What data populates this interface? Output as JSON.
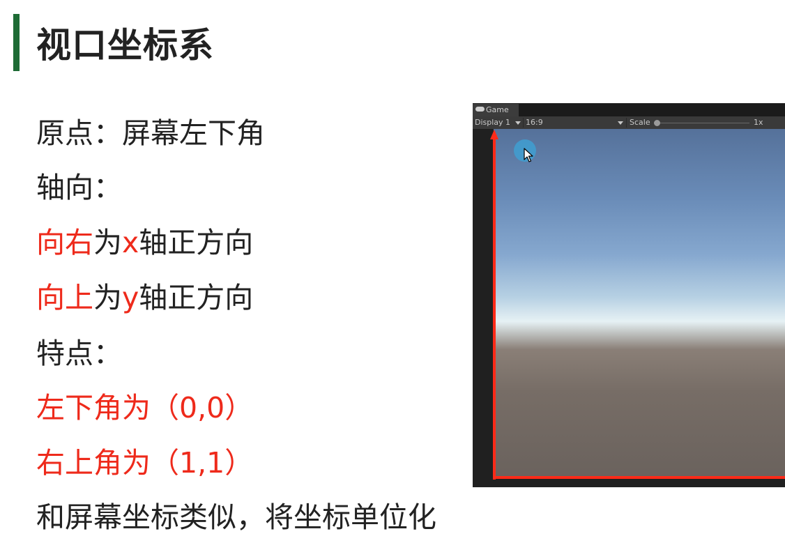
{
  "title": "视口坐标系",
  "lines": [
    {
      "segments": [
        {
          "text": "原点：屏幕左下角",
          "color": "dark"
        }
      ]
    },
    {
      "segments": [
        {
          "text": "轴向：",
          "color": "dark"
        }
      ]
    },
    {
      "segments": [
        {
          "text": "向右",
          "color": "red"
        },
        {
          "text": "为",
          "color": "dark"
        },
        {
          "text": "x",
          "color": "red"
        },
        {
          "text": "轴正方向",
          "color": "dark"
        }
      ]
    },
    {
      "segments": [
        {
          "text": "向上",
          "color": "red"
        },
        {
          "text": "为",
          "color": "dark"
        },
        {
          "text": "y",
          "color": "red"
        },
        {
          "text": "轴正方向",
          "color": "dark"
        }
      ]
    },
    {
      "segments": [
        {
          "text": "特点：",
          "color": "dark"
        }
      ]
    },
    {
      "segments": [
        {
          "text": "左下角为（0,0）",
          "color": "red"
        }
      ]
    },
    {
      "segments": [
        {
          "text": "右上角为（1,1）",
          "color": "red"
        }
      ]
    },
    {
      "segments": [
        {
          "text": "和屏幕坐标类似，将坐标单位化",
          "color": "dark"
        }
      ]
    }
  ],
  "game_view": {
    "tab_label": "Game",
    "tab_icon": "gamepad-icon",
    "display_label": "Display 1",
    "aspect_label": "16:9",
    "scale_label": "Scale",
    "scale_value": "1x",
    "cursor_icon": "mouse-pointer-icon"
  },
  "colors": {
    "accent_bar": "#1e6b35",
    "red_text": "#ee2a1b",
    "dark_text": "#222222",
    "axis": "#ff2a18"
  }
}
